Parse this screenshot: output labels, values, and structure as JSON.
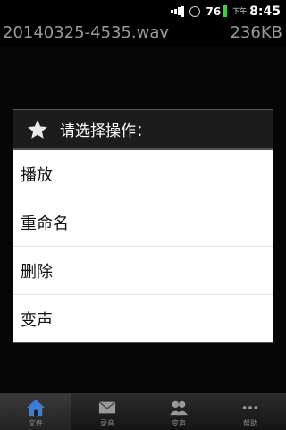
{
  "status_bar": {
    "battery_level": "76",
    "ampm": "下午",
    "time": "8:45",
    "battery_color": "#3ad13a"
  },
  "file": {
    "name": "20140325-4535.wav",
    "size": "236KB"
  },
  "dialog": {
    "title": "请选择操作：",
    "title_icon": "star-icon",
    "items": [
      {
        "label": "播放"
      },
      {
        "label": "重命名"
      },
      {
        "label": "删除"
      },
      {
        "label": "变声"
      }
    ]
  },
  "tabbar": {
    "tabs": [
      {
        "label": "文件",
        "icon": "home-icon",
        "active": true
      },
      {
        "label": "录音",
        "icon": "envelope-icon",
        "active": false
      },
      {
        "label": "变声",
        "icon": "people-icon",
        "active": false
      },
      {
        "label": "帮助",
        "icon": "more-icon",
        "active": false
      }
    ],
    "active_color": "#3b7dd8"
  }
}
